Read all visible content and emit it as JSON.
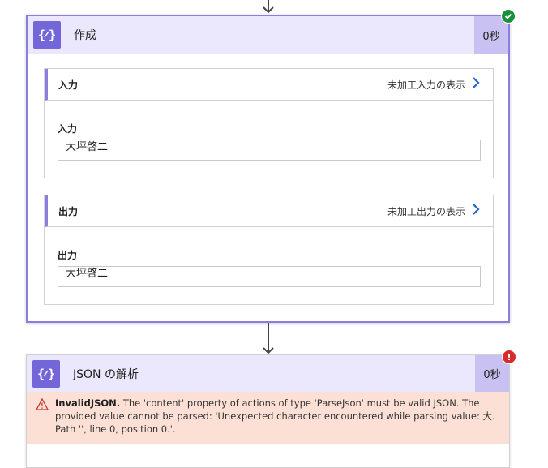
{
  "card1": {
    "title": "作成",
    "duration": "0秒",
    "status": "success",
    "input_section": {
      "header": "入力",
      "raw_link": "未加工入力の表示",
      "field_label": "入力",
      "field_value": "大坪啓二"
    },
    "output_section": {
      "header": "出力",
      "raw_link": "未加工出力の表示",
      "field_label": "出力",
      "field_value": "大坪啓二"
    }
  },
  "card2": {
    "title": "JSON の解析",
    "duration": "0秒",
    "status": "error",
    "error_title": "InvalidJSON.",
    "error_message": " The 'content' property of actions of type 'ParseJson' must be valid JSON. The provided value cannot be parsed: 'Unexpected character encountered while parsing value: 大. Path '', line 0, position 0.'."
  },
  "colors": {
    "accent": "#7266d9",
    "header_bg": "#ebe7fc",
    "success": "#1a8f3c",
    "error": "#d92b2b",
    "error_bg": "#fde0d5"
  },
  "icons": {
    "action": "{ }",
    "success": "✓",
    "error": "!",
    "warning": "⚠",
    "chevron": "›"
  }
}
